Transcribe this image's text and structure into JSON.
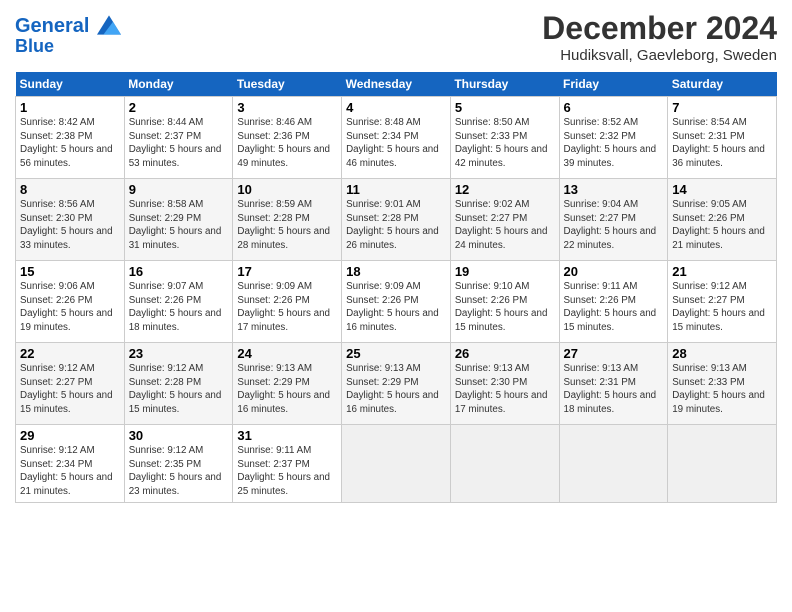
{
  "header": {
    "logo_line1": "General",
    "logo_line2": "Blue",
    "month": "December 2024",
    "location": "Hudiksvall, Gaevleborg, Sweden"
  },
  "days_of_week": [
    "Sunday",
    "Monday",
    "Tuesday",
    "Wednesday",
    "Thursday",
    "Friday",
    "Saturday"
  ],
  "weeks": [
    [
      {
        "day": "1",
        "sunrise": "8:42 AM",
        "sunset": "2:38 PM",
        "daylight": "5 hours and 56 minutes."
      },
      {
        "day": "2",
        "sunrise": "8:44 AM",
        "sunset": "2:37 PM",
        "daylight": "5 hours and 53 minutes."
      },
      {
        "day": "3",
        "sunrise": "8:46 AM",
        "sunset": "2:36 PM",
        "daylight": "5 hours and 49 minutes."
      },
      {
        "day": "4",
        "sunrise": "8:48 AM",
        "sunset": "2:34 PM",
        "daylight": "5 hours and 46 minutes."
      },
      {
        "day": "5",
        "sunrise": "8:50 AM",
        "sunset": "2:33 PM",
        "daylight": "5 hours and 42 minutes."
      },
      {
        "day": "6",
        "sunrise": "8:52 AM",
        "sunset": "2:32 PM",
        "daylight": "5 hours and 39 minutes."
      },
      {
        "day": "7",
        "sunrise": "8:54 AM",
        "sunset": "2:31 PM",
        "daylight": "5 hours and 36 minutes."
      }
    ],
    [
      {
        "day": "8",
        "sunrise": "8:56 AM",
        "sunset": "2:30 PM",
        "daylight": "5 hours and 33 minutes."
      },
      {
        "day": "9",
        "sunrise": "8:58 AM",
        "sunset": "2:29 PM",
        "daylight": "5 hours and 31 minutes."
      },
      {
        "day": "10",
        "sunrise": "8:59 AM",
        "sunset": "2:28 PM",
        "daylight": "5 hours and 28 minutes."
      },
      {
        "day": "11",
        "sunrise": "9:01 AM",
        "sunset": "2:28 PM",
        "daylight": "5 hours and 26 minutes."
      },
      {
        "day": "12",
        "sunrise": "9:02 AM",
        "sunset": "2:27 PM",
        "daylight": "5 hours and 24 minutes."
      },
      {
        "day": "13",
        "sunrise": "9:04 AM",
        "sunset": "2:27 PM",
        "daylight": "5 hours and 22 minutes."
      },
      {
        "day": "14",
        "sunrise": "9:05 AM",
        "sunset": "2:26 PM",
        "daylight": "5 hours and 21 minutes."
      }
    ],
    [
      {
        "day": "15",
        "sunrise": "9:06 AM",
        "sunset": "2:26 PM",
        "daylight": "5 hours and 19 minutes."
      },
      {
        "day": "16",
        "sunrise": "9:07 AM",
        "sunset": "2:26 PM",
        "daylight": "5 hours and 18 minutes."
      },
      {
        "day": "17",
        "sunrise": "9:09 AM",
        "sunset": "2:26 PM",
        "daylight": "5 hours and 17 minutes."
      },
      {
        "day": "18",
        "sunrise": "9:09 AM",
        "sunset": "2:26 PM",
        "daylight": "5 hours and 16 minutes."
      },
      {
        "day": "19",
        "sunrise": "9:10 AM",
        "sunset": "2:26 PM",
        "daylight": "5 hours and 15 minutes."
      },
      {
        "day": "20",
        "sunrise": "9:11 AM",
        "sunset": "2:26 PM",
        "daylight": "5 hours and 15 minutes."
      },
      {
        "day": "21",
        "sunrise": "9:12 AM",
        "sunset": "2:27 PM",
        "daylight": "5 hours and 15 minutes."
      }
    ],
    [
      {
        "day": "22",
        "sunrise": "9:12 AM",
        "sunset": "2:27 PM",
        "daylight": "5 hours and 15 minutes."
      },
      {
        "day": "23",
        "sunrise": "9:12 AM",
        "sunset": "2:28 PM",
        "daylight": "5 hours and 15 minutes."
      },
      {
        "day": "24",
        "sunrise": "9:13 AM",
        "sunset": "2:29 PM",
        "daylight": "5 hours and 16 minutes."
      },
      {
        "day": "25",
        "sunrise": "9:13 AM",
        "sunset": "2:29 PM",
        "daylight": "5 hours and 16 minutes."
      },
      {
        "day": "26",
        "sunrise": "9:13 AM",
        "sunset": "2:30 PM",
        "daylight": "5 hours and 17 minutes."
      },
      {
        "day": "27",
        "sunrise": "9:13 AM",
        "sunset": "2:31 PM",
        "daylight": "5 hours and 18 minutes."
      },
      {
        "day": "28",
        "sunrise": "9:13 AM",
        "sunset": "2:33 PM",
        "daylight": "5 hours and 19 minutes."
      }
    ],
    [
      {
        "day": "29",
        "sunrise": "9:12 AM",
        "sunset": "2:34 PM",
        "daylight": "5 hours and 21 minutes."
      },
      {
        "day": "30",
        "sunrise": "9:12 AM",
        "sunset": "2:35 PM",
        "daylight": "5 hours and 23 minutes."
      },
      {
        "day": "31",
        "sunrise": "9:11 AM",
        "sunset": "2:37 PM",
        "daylight": "5 hours and 25 minutes."
      },
      null,
      null,
      null,
      null
    ]
  ]
}
